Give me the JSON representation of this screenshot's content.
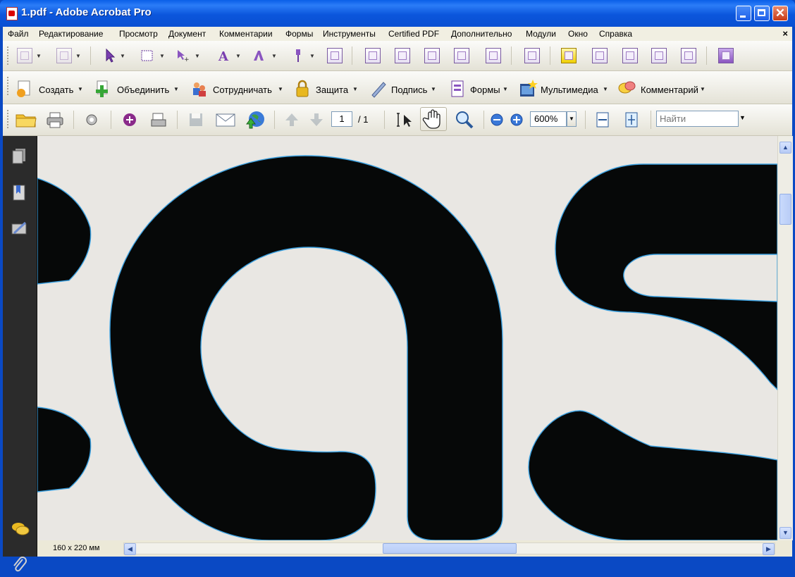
{
  "window": {
    "title": "1.pdf - Adobe Acrobat Pro",
    "close_glyph": "✕"
  },
  "menu": {
    "items": [
      "Файл",
      "Редактирование",
      "Просмотр",
      "Документ",
      "Комментарии",
      "Формы",
      "Инструменты",
      "Certified PDF",
      "Дополнительно",
      "Модули",
      "Окно",
      "Справка"
    ],
    "close_glyph": "×"
  },
  "tasks": {
    "create": "Создать",
    "combine": "Объединить",
    "collaborate": "Сотрудничать",
    "secure": "Защита",
    "sign": "Подпись",
    "forms": "Формы",
    "multimedia": "Мультимедиа",
    "comment": "Комментарий"
  },
  "navigation": {
    "current_page": "1",
    "page_total": "/ 1",
    "zoom": "600%",
    "search_placeholder": "Найти"
  },
  "status": {
    "page_size": "160 x 220 мм"
  },
  "icons": {
    "nav_pages": "pages-icon",
    "nav_bookmarks": "bookmarks-icon",
    "nav_signatures": "signatures-icon",
    "nav_comments": "comments-icon",
    "nav_attachments": "attachments-icon"
  },
  "colors": {
    "titlebar": "#0a5fe8",
    "ink": "#060808",
    "outline": "#3aa0e0"
  }
}
